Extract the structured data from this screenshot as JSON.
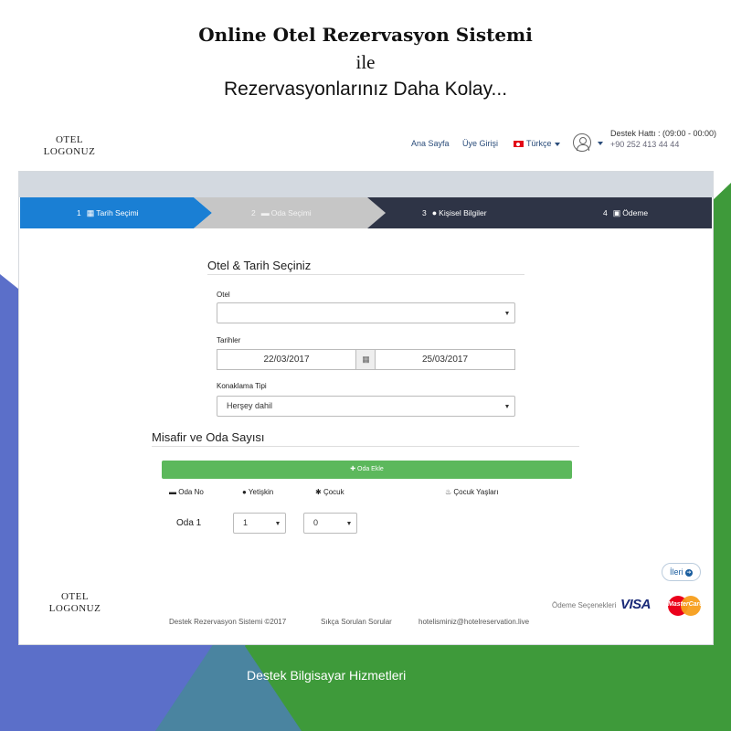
{
  "headline": {
    "line1": "Online Otel Rezervasyon Sistemi",
    "line2": "ile",
    "line3": "Rezervasyonlarınız Daha Kolay..."
  },
  "logo": {
    "line1": "OTEL",
    "line2": "LOGONUZ"
  },
  "nav": {
    "home": "Ana Sayfa",
    "login": "Üye Girişi",
    "language": "Türkçe",
    "support_title": "Destek Hattı : (09:00 - 00:00)",
    "support_phone": "+90 252 413 44 44"
  },
  "steps": [
    {
      "num": "1",
      "label": "Tarih Seçimi",
      "icon": "calendar-icon"
    },
    {
      "num": "2",
      "label": "Oda Seçimi",
      "icon": "bed-icon"
    },
    {
      "num": "3",
      "label": "Kişisel Bilgiler",
      "icon": "user-icon"
    },
    {
      "num": "4",
      "label": "Ödeme",
      "icon": "credit-card-icon"
    }
  ],
  "form": {
    "section_title": "Otel & Tarih Seçiniz",
    "hotel_label": "Otel",
    "hotel_value": "",
    "dates_label": "Tarihler",
    "date_start": "22/03/2017",
    "date_end": "25/03/2017",
    "board_label": "Konaklama Tipi",
    "board_value": "Herşey dahil"
  },
  "rooms": {
    "section_title": "Misafir ve Oda Sayısı",
    "add_room": "Oda Ekle",
    "col_room": "Oda No",
    "col_adult": "Yetişkin",
    "col_child": "Çocuk",
    "col_child_ages": "Çocuk Yaşları",
    "room_label": "Oda 1",
    "adult_value": "1",
    "child_value": "0"
  },
  "next_button": "İleri",
  "footer": {
    "copyright": "Destek Rezervasyon Sistemi ©2017",
    "faq": "Sıkça Sorulan Sorular",
    "email": "hotelisminiz@hotelreservation.live",
    "payment_label": "Ödeme Seçenekleri",
    "visa": "VISA",
    "mastercard": "MasterCard"
  },
  "bottom_text": "Destek Bilgisayar Hizmetleri",
  "colors": {
    "step_active": "#1a7fd4",
    "step_inactive": "#c6c6c6",
    "step_dark": "#2e3446",
    "add_room_green": "#5cb85c",
    "bg_blue": "#5b6fc9",
    "bg_green": "#3e9a3a"
  }
}
